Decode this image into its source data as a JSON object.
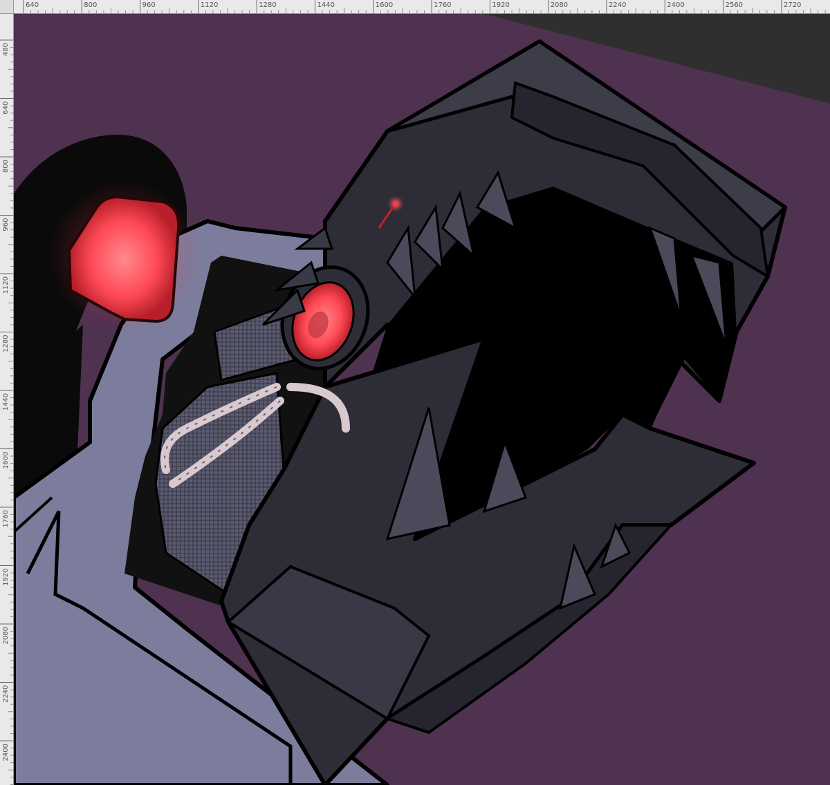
{
  "app": {
    "rulers": {
      "horizontal_ticks": [
        "640",
        "800",
        "960",
        "1120",
        "1280",
        "1440",
        "1600",
        "1760",
        "1920",
        "2080",
        "2240",
        "2400",
        "2560",
        "2720"
      ],
      "vertical_ticks": [
        "480",
        "640",
        "800",
        "960",
        "1120",
        "1280",
        "1440",
        "1600",
        "1760",
        "1920",
        "2080",
        "2240",
        "2400"
      ]
    },
    "canvas": {
      "subject": "robot-with-dragon-head-illustration",
      "colors": {
        "background": "#4f3150",
        "workspace": "#2f2f2f",
        "body": "#7c7c9c",
        "dark_metal": "#2e2d37",
        "mouth": "#000000",
        "glow": "#ff5a63"
      }
    }
  }
}
